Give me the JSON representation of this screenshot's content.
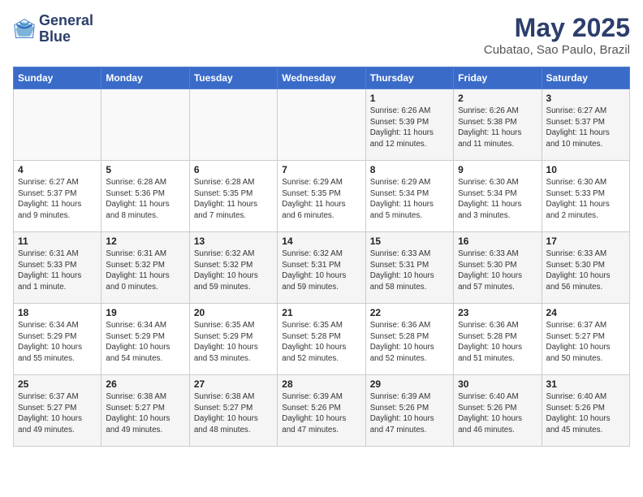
{
  "header": {
    "logo_line1": "General",
    "logo_line2": "Blue",
    "month_title": "May 2025",
    "location": "Cubatao, Sao Paulo, Brazil"
  },
  "weekdays": [
    "Sunday",
    "Monday",
    "Tuesday",
    "Wednesday",
    "Thursday",
    "Friday",
    "Saturday"
  ],
  "weeks": [
    [
      {
        "day": "",
        "info": ""
      },
      {
        "day": "",
        "info": ""
      },
      {
        "day": "",
        "info": ""
      },
      {
        "day": "",
        "info": ""
      },
      {
        "day": "1",
        "info": "Sunrise: 6:26 AM\nSunset: 5:39 PM\nDaylight: 11 hours\nand 12 minutes."
      },
      {
        "day": "2",
        "info": "Sunrise: 6:26 AM\nSunset: 5:38 PM\nDaylight: 11 hours\nand 11 minutes."
      },
      {
        "day": "3",
        "info": "Sunrise: 6:27 AM\nSunset: 5:37 PM\nDaylight: 11 hours\nand 10 minutes."
      }
    ],
    [
      {
        "day": "4",
        "info": "Sunrise: 6:27 AM\nSunset: 5:37 PM\nDaylight: 11 hours\nand 9 minutes."
      },
      {
        "day": "5",
        "info": "Sunrise: 6:28 AM\nSunset: 5:36 PM\nDaylight: 11 hours\nand 8 minutes."
      },
      {
        "day": "6",
        "info": "Sunrise: 6:28 AM\nSunset: 5:35 PM\nDaylight: 11 hours\nand 7 minutes."
      },
      {
        "day": "7",
        "info": "Sunrise: 6:29 AM\nSunset: 5:35 PM\nDaylight: 11 hours\nand 6 minutes."
      },
      {
        "day": "8",
        "info": "Sunrise: 6:29 AM\nSunset: 5:34 PM\nDaylight: 11 hours\nand 5 minutes."
      },
      {
        "day": "9",
        "info": "Sunrise: 6:30 AM\nSunset: 5:34 PM\nDaylight: 11 hours\nand 3 minutes."
      },
      {
        "day": "10",
        "info": "Sunrise: 6:30 AM\nSunset: 5:33 PM\nDaylight: 11 hours\nand 2 minutes."
      }
    ],
    [
      {
        "day": "11",
        "info": "Sunrise: 6:31 AM\nSunset: 5:33 PM\nDaylight: 11 hours\nand 1 minute."
      },
      {
        "day": "12",
        "info": "Sunrise: 6:31 AM\nSunset: 5:32 PM\nDaylight: 11 hours\nand 0 minutes."
      },
      {
        "day": "13",
        "info": "Sunrise: 6:32 AM\nSunset: 5:32 PM\nDaylight: 10 hours\nand 59 minutes."
      },
      {
        "day": "14",
        "info": "Sunrise: 6:32 AM\nSunset: 5:31 PM\nDaylight: 10 hours\nand 59 minutes."
      },
      {
        "day": "15",
        "info": "Sunrise: 6:33 AM\nSunset: 5:31 PM\nDaylight: 10 hours\nand 58 minutes."
      },
      {
        "day": "16",
        "info": "Sunrise: 6:33 AM\nSunset: 5:30 PM\nDaylight: 10 hours\nand 57 minutes."
      },
      {
        "day": "17",
        "info": "Sunrise: 6:33 AM\nSunset: 5:30 PM\nDaylight: 10 hours\nand 56 minutes."
      }
    ],
    [
      {
        "day": "18",
        "info": "Sunrise: 6:34 AM\nSunset: 5:29 PM\nDaylight: 10 hours\nand 55 minutes."
      },
      {
        "day": "19",
        "info": "Sunrise: 6:34 AM\nSunset: 5:29 PM\nDaylight: 10 hours\nand 54 minutes."
      },
      {
        "day": "20",
        "info": "Sunrise: 6:35 AM\nSunset: 5:29 PM\nDaylight: 10 hours\nand 53 minutes."
      },
      {
        "day": "21",
        "info": "Sunrise: 6:35 AM\nSunset: 5:28 PM\nDaylight: 10 hours\nand 52 minutes."
      },
      {
        "day": "22",
        "info": "Sunrise: 6:36 AM\nSunset: 5:28 PM\nDaylight: 10 hours\nand 52 minutes."
      },
      {
        "day": "23",
        "info": "Sunrise: 6:36 AM\nSunset: 5:28 PM\nDaylight: 10 hours\nand 51 minutes."
      },
      {
        "day": "24",
        "info": "Sunrise: 6:37 AM\nSunset: 5:27 PM\nDaylight: 10 hours\nand 50 minutes."
      }
    ],
    [
      {
        "day": "25",
        "info": "Sunrise: 6:37 AM\nSunset: 5:27 PM\nDaylight: 10 hours\nand 49 minutes."
      },
      {
        "day": "26",
        "info": "Sunrise: 6:38 AM\nSunset: 5:27 PM\nDaylight: 10 hours\nand 49 minutes."
      },
      {
        "day": "27",
        "info": "Sunrise: 6:38 AM\nSunset: 5:27 PM\nDaylight: 10 hours\nand 48 minutes."
      },
      {
        "day": "28",
        "info": "Sunrise: 6:39 AM\nSunset: 5:26 PM\nDaylight: 10 hours\nand 47 minutes."
      },
      {
        "day": "29",
        "info": "Sunrise: 6:39 AM\nSunset: 5:26 PM\nDaylight: 10 hours\nand 47 minutes."
      },
      {
        "day": "30",
        "info": "Sunrise: 6:40 AM\nSunset: 5:26 PM\nDaylight: 10 hours\nand 46 minutes."
      },
      {
        "day": "31",
        "info": "Sunrise: 6:40 AM\nSunset: 5:26 PM\nDaylight: 10 hours\nand 45 minutes."
      }
    ]
  ]
}
